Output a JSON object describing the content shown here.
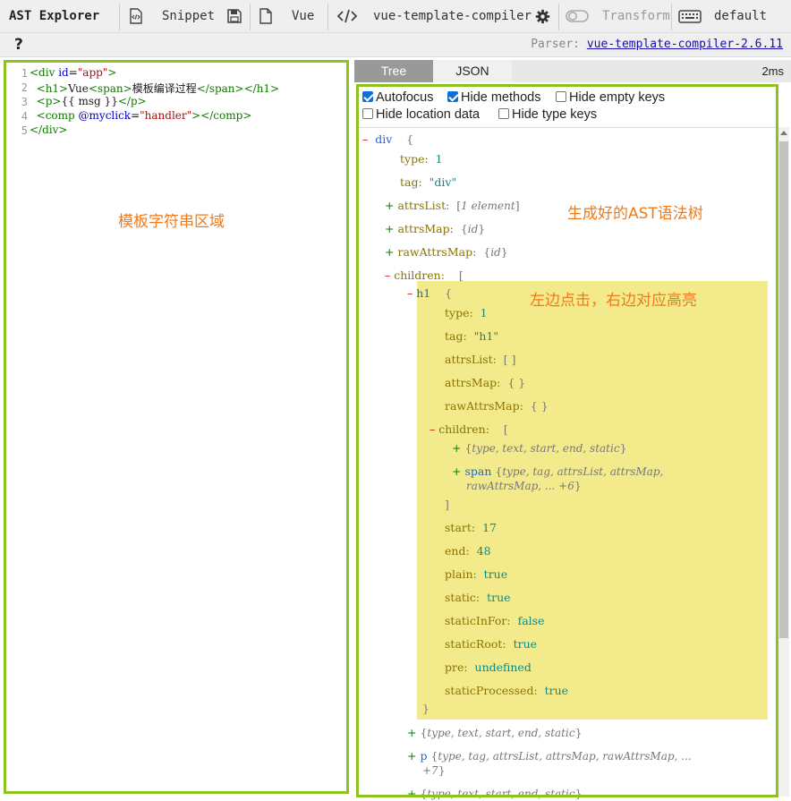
{
  "toolbar": {
    "app_title": "AST Explorer",
    "snippet_label": "Snippet",
    "language_label": "Vue",
    "parser_label": "vue-template-compiler",
    "transform_label": "Transform",
    "keymap_label": "default",
    "help_label": "?",
    "parser_prefix": "Parser:",
    "parser_version": "vue-template-compiler-2.6.11"
  },
  "editor": {
    "line_numbers": [
      "1",
      "2",
      "3",
      "4",
      "5"
    ],
    "annotation": "模板字符串区域"
  },
  "tabs": {
    "tree": "Tree",
    "json": "JSON",
    "time": "2ms"
  },
  "options": {
    "autofocus": "Autofocus",
    "hide_methods": "Hide methods",
    "hide_empty_keys": "Hide empty keys",
    "hide_location_data": "Hide location data",
    "hide_type_keys": "Hide type keys"
  },
  "annotations": {
    "ast": "生成好的AST语法树",
    "highlight": "左边点击，右边对应高亮"
  },
  "colors": {
    "frame_green": "#8dc21f",
    "highlight_yellow": "#f3ea8c",
    "annotation_orange": "#f07a1a",
    "tab_active": "#999999"
  }
}
